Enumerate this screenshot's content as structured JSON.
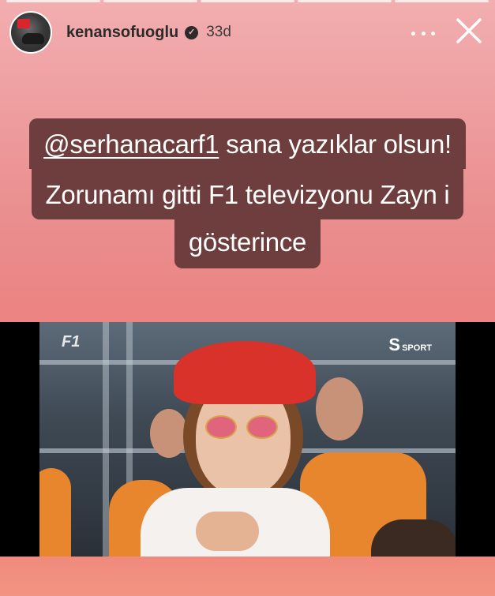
{
  "story": {
    "progress_segments": 5,
    "user": {
      "username": "kenansofuoglu",
      "verified_mark": "✓",
      "posted_ago": "33d"
    },
    "icons": {
      "more": "more-dots-icon",
      "close": "close-icon",
      "verified": "verified-badge-icon"
    },
    "caption": {
      "mention": "@serhanacarf1",
      "line1_rest": " sana yazıklar olsun!",
      "line2": "Zorunamı gitti  F1 televizyonu Zayn i",
      "line3": "gösterince"
    },
    "photo": {
      "f1_logo": "F1",
      "broadcaster_logo_letter": "S",
      "broadcaster_logo_text": "SPORT"
    },
    "colors": {
      "caption_bg": "#6e3d3d",
      "background_top": "#f2aeb0",
      "background_bottom": "#f08a7c"
    }
  }
}
